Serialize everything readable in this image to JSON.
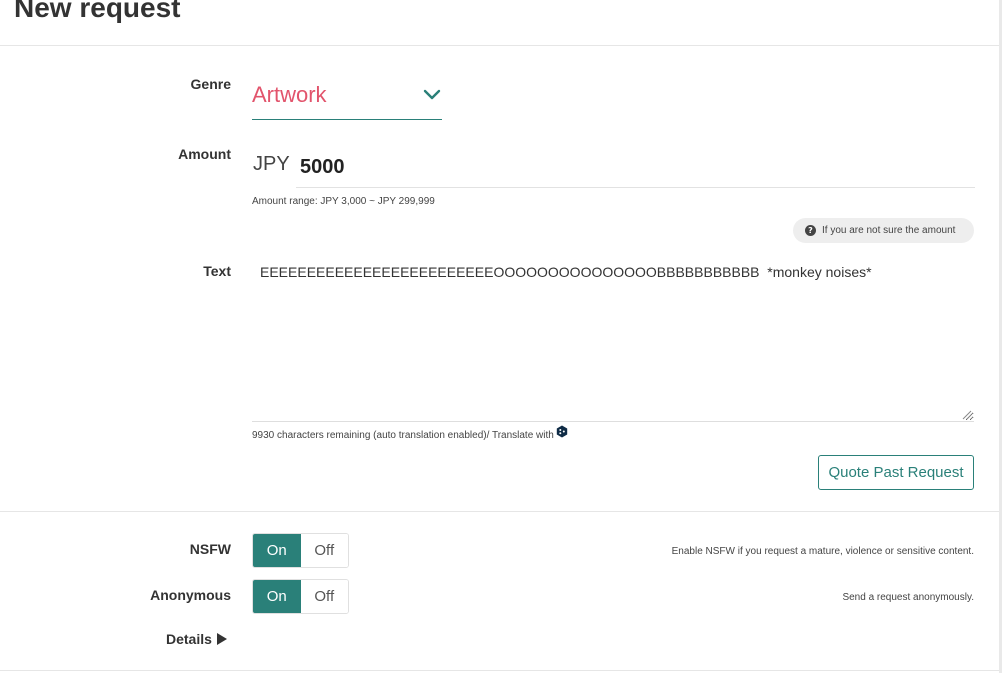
{
  "page": {
    "title": "New request"
  },
  "genre": {
    "label": "Genre",
    "value": "Artwork",
    "icon": "chevron-down-icon"
  },
  "amount": {
    "label": "Amount",
    "currency": "JPY",
    "value": "5000",
    "range_note": "Amount range: JPY 3,000 ~ JPY 299,999",
    "help_text": "If you are not sure the amount"
  },
  "text": {
    "label": "Text",
    "value": "EEEEEEEEEEEEEEEEEEEEEEEEEOOOOOOOOOOOOOOOBBBBBBBBBBB  *monkey noises*",
    "remaining_note": "9930 characters remaining (auto translation enabled)/ Translate with"
  },
  "quote_button": {
    "label": "Quote Past Request"
  },
  "nsfw": {
    "label": "NSFW",
    "on_label": "On",
    "off_label": "Off",
    "selected": "On",
    "hint": "Enable NSFW if you request a mature, violence or sensitive content."
  },
  "anonymous": {
    "label": "Anonymous",
    "on_label": "On",
    "off_label": "Off",
    "selected": "On",
    "hint": "Send a request anonymously."
  },
  "details": {
    "label": "Details"
  },
  "colors": {
    "accent": "#2a8079",
    "genre_text": "#e2546c"
  }
}
